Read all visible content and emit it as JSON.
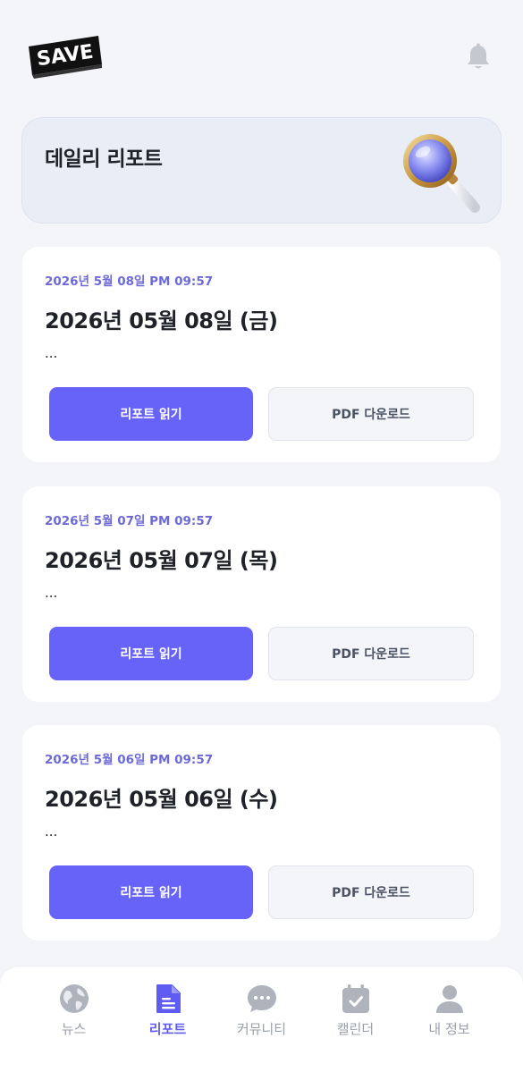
{
  "header": {
    "logo_text": "SAVE",
    "bell_icon": "bell-icon"
  },
  "banner": {
    "title": "데일리 리포트",
    "icon": "magnifier-icon"
  },
  "reports": [
    {
      "time": "2026년 5월 08일 PM 09:57",
      "title": "2026년 05월 08일 (금)",
      "summary": "...",
      "read_label": "리포트 읽기",
      "pdf_label": "PDF 다운로드"
    },
    {
      "time": "2026년 5월 07일 PM 09:57",
      "title": "2026년 05월 07일 (목)",
      "summary": "...",
      "read_label": "리포트 읽기",
      "pdf_label": "PDF 다운로드"
    },
    {
      "time": "2026년 5월 06일 PM 09:57",
      "title": "2026년 05월 06일 (수)",
      "summary": "...",
      "read_label": "리포트 읽기",
      "pdf_label": "PDF 다운로드"
    }
  ],
  "bottom_nav": {
    "items": [
      {
        "label": "뉴스",
        "icon": "globe-icon",
        "active": false
      },
      {
        "label": "리포트",
        "icon": "document-icon",
        "active": true
      },
      {
        "label": "커뮤니티",
        "icon": "chat-bubble-icon",
        "active": false
      },
      {
        "label": "캘린더",
        "icon": "calendar-check-icon",
        "active": false
      },
      {
        "label": "내 정보",
        "icon": "person-icon",
        "active": false
      }
    ]
  },
  "colors": {
    "accent": "#6763f8",
    "accent_text": "#6d6ad8",
    "background": "#f4f5f9",
    "inactive_nav": "#9aa0ab"
  }
}
